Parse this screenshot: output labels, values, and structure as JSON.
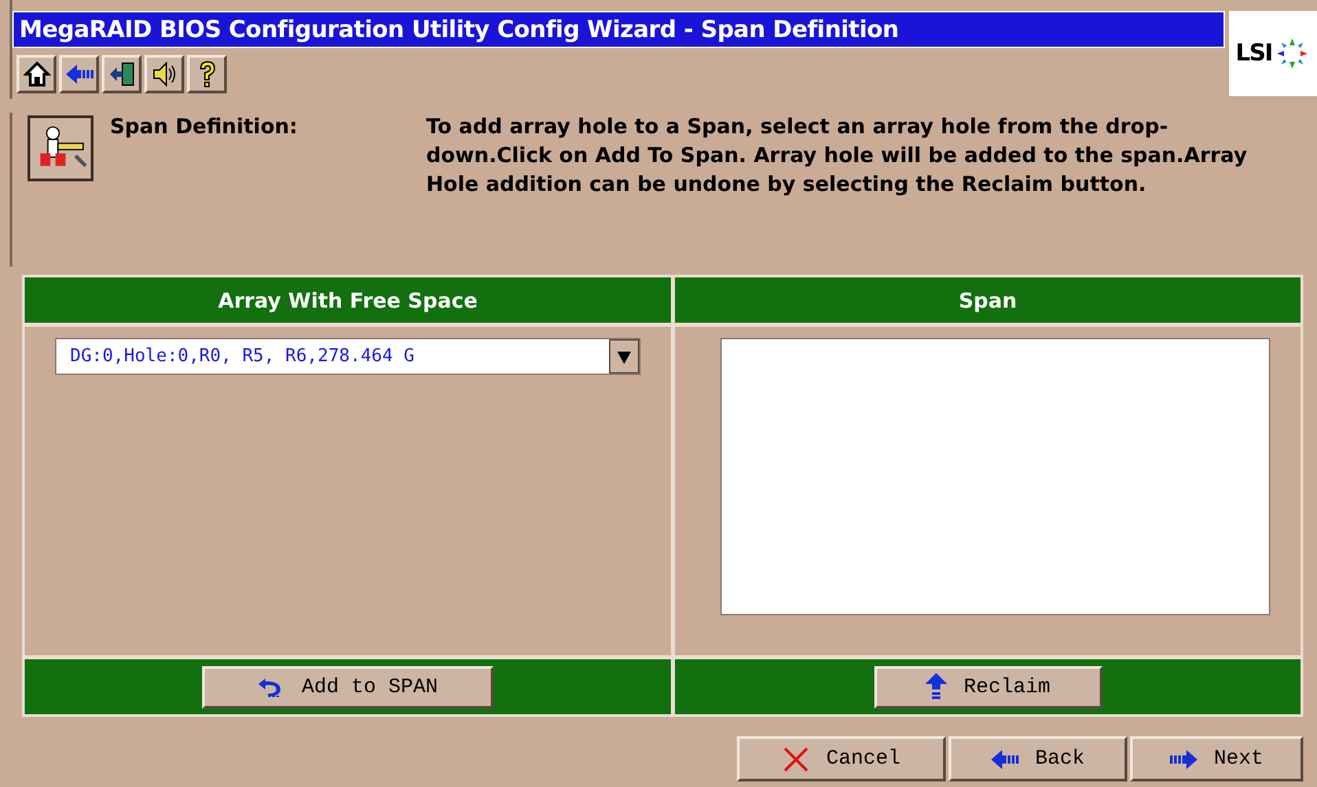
{
  "window": {
    "title": "MegaRAID BIOS Configuration Utility Config Wizard - Span Definition"
  },
  "logo": "LSI",
  "section": {
    "label": "Span Definition:",
    "text": "To add array hole to a Span, select an array hole from the drop-down.Click on Add To Span. Array hole will be added to the span.Array Hole addition can be undone by selecting the Reclaim button."
  },
  "panels": [
    {
      "header": "Array With Free Space",
      "kind": "dropdown",
      "value": "DG:0,Hole:0,R0, R5, R6,278.464 G",
      "button": "Add to SPAN"
    },
    {
      "header": "Span",
      "kind": "list",
      "button": "Reclaim"
    }
  ],
  "buttons": [
    "Cancel",
    "Back",
    "Next"
  ]
}
